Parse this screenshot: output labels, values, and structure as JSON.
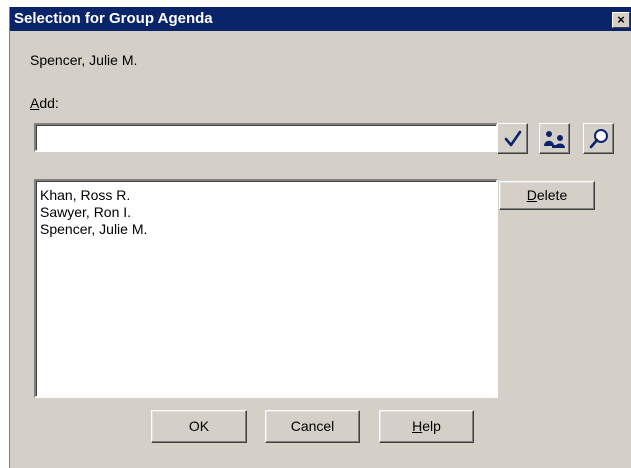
{
  "window": {
    "title": "Selection for Group Agenda",
    "close_glyph": "×"
  },
  "user_name": "Spencer, Julie M.",
  "add": {
    "label_mnemonic": "A",
    "label_rest": "dd:",
    "value": "",
    "placeholder": ""
  },
  "tool_buttons": {
    "check_icon": "check-icon",
    "group_icon": "group-icon",
    "find_icon": "find-icon"
  },
  "members": [
    "Khan, Ross R.",
    "Sawyer, Ron I.",
    "Spencer, Julie M."
  ],
  "buttons": {
    "delete_mnemonic": "D",
    "delete_rest": "elete",
    "ok": "OK",
    "cancel": "Cancel",
    "help_mnemonic": "H",
    "help_rest": "elp"
  },
  "colors": {
    "titlebar": "#0a246a",
    "face": "#d4d0c8",
    "check": "#0a246a"
  }
}
